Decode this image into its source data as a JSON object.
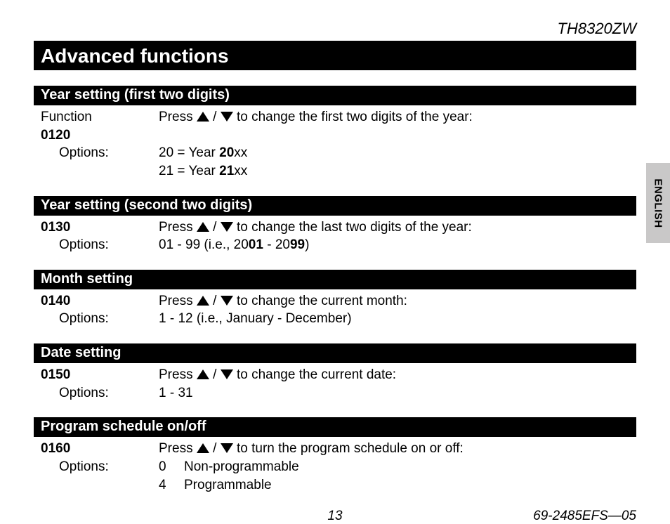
{
  "header": {
    "model": "TH8320ZW"
  },
  "page_title": "Advanced functions",
  "language_tab": "ENGLISH",
  "labels": {
    "function": "Function",
    "options": "Options:",
    "press_prefix": "Press ",
    "slash": " / "
  },
  "sections": [
    {
      "title": "Year setting (first two digits)",
      "code": "0120",
      "show_function_label": true,
      "instruction_suffix": " to change the first two digits of the year:",
      "options_kind": "year_first",
      "option_lines": [
        {
          "code": "20",
          "eq": " = Year ",
          "bold": "20",
          "tail": "xx"
        },
        {
          "code": "21",
          "eq": " = Year ",
          "bold": "21",
          "tail": "xx"
        }
      ]
    },
    {
      "title": "Year setting (second two digits)",
      "code": "0130",
      "show_function_label": false,
      "instruction_suffix": " to change the last two digits of the year:",
      "options_kind": "year_second",
      "range": {
        "pre": "01 - 99 (i.e., 20",
        "b1": "01",
        "mid": " - 20",
        "b2": "99",
        "post": ")"
      }
    },
    {
      "title": "Month setting",
      "code": "0140",
      "show_function_label": false,
      "instruction_suffix": " to change the current month:",
      "options_kind": "simple",
      "options_text": "1 - 12 (i.e., January - December)"
    },
    {
      "title": "Date setting",
      "code": "0150",
      "show_function_label": false,
      "instruction_suffix": " to change the current date:",
      "options_kind": "simple",
      "options_text": "1 - 31"
    },
    {
      "title": "Program schedule on/off",
      "code": "0160",
      "show_function_label": false,
      "instruction_suffix": " to turn the program schedule on or off:",
      "options_kind": "list",
      "option_list": [
        {
          "code": "0",
          "label": "Non-programmable"
        },
        {
          "code": "4",
          "label": "Programmable"
        }
      ]
    }
  ],
  "footer": {
    "page_number": "13",
    "doc_number": "69-2485EFS—05"
  }
}
